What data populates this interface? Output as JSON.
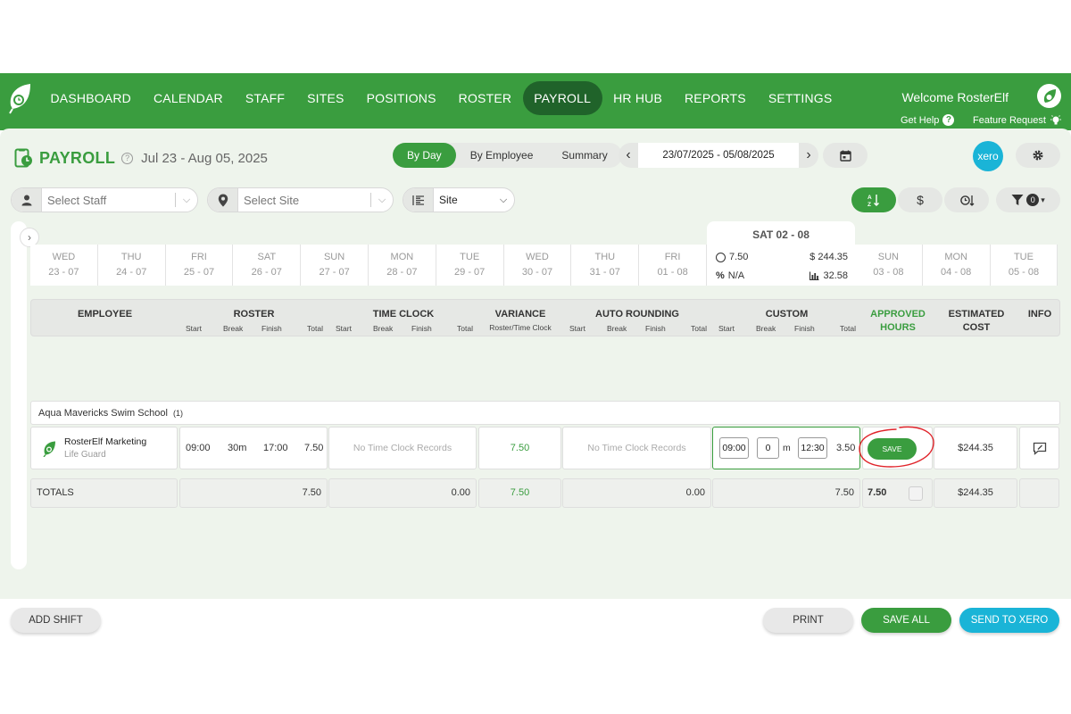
{
  "nav": {
    "items": [
      "DASHBOARD",
      "CALENDAR",
      "STAFF",
      "SITES",
      "POSITIONS",
      "ROSTER",
      "PAYROLL",
      "HR HUB",
      "REPORTS",
      "SETTINGS"
    ],
    "active": "PAYROLL",
    "welcome": "Welcome RosterElf",
    "get_help": "Get Help",
    "feature_request": "Feature Request"
  },
  "header": {
    "title": "PAYROLL",
    "date_range": "Jul 23 - Aug 05, 2025",
    "views": [
      "By Day",
      "By Employee",
      "Summary"
    ],
    "active_view": "By Day",
    "date_input": "23/07/2025 - 05/08/2025",
    "xero_label": "xero"
  },
  "filters": {
    "staff_placeholder": "Select Staff",
    "site_placeholder": "Select Site",
    "group_by": "Site",
    "filter_count": "0"
  },
  "days": [
    {
      "name": "WED",
      "date": "23 - 07"
    },
    {
      "name": "THU",
      "date": "24 - 07"
    },
    {
      "name": "FRI",
      "date": "25 - 07"
    },
    {
      "name": "SAT",
      "date": "26 - 07"
    },
    {
      "name": "SUN",
      "date": "27 - 07"
    },
    {
      "name": "MON",
      "date": "28 - 07"
    },
    {
      "name": "TUE",
      "date": "29 - 07"
    },
    {
      "name": "WED",
      "date": "30 - 07"
    },
    {
      "name": "THU",
      "date": "31 - 07"
    },
    {
      "name": "FRI",
      "date": "01 - 08"
    },
    {
      "name": "SUN",
      "date": "03 - 08"
    },
    {
      "name": "MON",
      "date": "04 - 08"
    },
    {
      "name": "TUE",
      "date": "05 - 08"
    }
  ],
  "selected_day": {
    "title": "SAT 02 - 08",
    "hours": "7.50",
    "cost": "$ 244.35",
    "percent": "N/A",
    "stat": "32.58"
  },
  "table": {
    "headers": {
      "employee": "EMPLOYEE",
      "roster": "ROSTER",
      "time_clock": "TIME CLOCK",
      "variance": "VARIANCE",
      "variance_sub": "Roster/Time Clock",
      "auto_rounding": "AUTO ROUNDING",
      "custom": "CUSTOM",
      "approved": "APPROVED",
      "hours": "HOURS",
      "estimated": "ESTIMATED",
      "cost": "COST",
      "info": "INFO",
      "start": "Start",
      "break": "Break",
      "finish": "Finish",
      "total": "Total"
    },
    "group": "Aqua Mavericks Swim School",
    "group_count": "(1)",
    "row": {
      "employee_name": "RosterElf Marketing",
      "position": "Life Guard",
      "roster_start": "09:00",
      "roster_break": "30m",
      "roster_finish": "17:00",
      "roster_total": "7.50",
      "time_clock": "No Time Clock Records",
      "variance": "7.50",
      "auto_rounding": "No Time Clock Records",
      "custom_start": "09:00",
      "custom_break": "0",
      "custom_break_unit": "m",
      "custom_finish": "12:30",
      "custom_total": "3.50",
      "save_label": "SAVE",
      "estimated_cost": "$244.35"
    },
    "totals": {
      "label": "TOTALS",
      "roster": "7.50",
      "time_clock": "0.00",
      "variance": "7.50",
      "auto_rounding": "0.00",
      "custom": "7.50",
      "approved": "7.50",
      "cost": "$244.35"
    }
  },
  "footer": {
    "add_shift": "ADD SHIFT",
    "print": "PRINT",
    "save_all": "SAVE ALL",
    "send_to_xero": "SEND TO XERO"
  },
  "colors": {
    "brand_green": "#3a9d3f",
    "nav_active": "#20632a",
    "xero_blue": "#1ab4d7",
    "annotation_red": "#e0242b"
  }
}
